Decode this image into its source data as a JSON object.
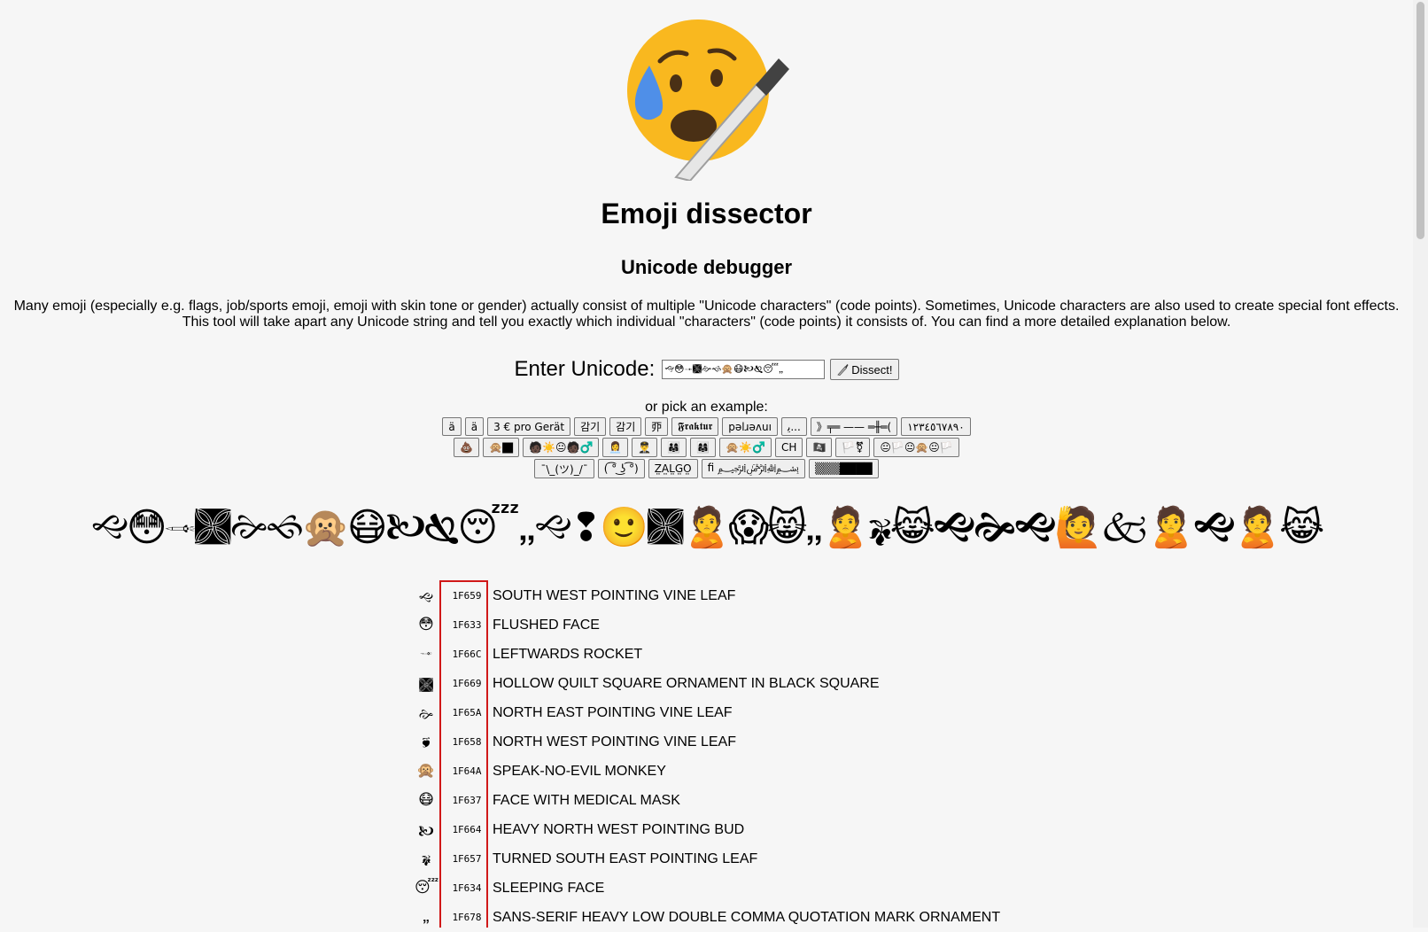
{
  "header": {
    "title": "Emoji dissector",
    "subtitle": "Unicode debugger",
    "intro_line1": "Many emoji (especially e.g. flags, job/sports emoji, emoji with skin tone or gender) actually consist of multiple \"Unicode characters\" (code points). Sometimes, Unicode characters are also used to create special font effects.",
    "intro_line2": "This tool will take apart any Unicode string and tell you exactly which individual \"characters\" (code points) it consists of. You can find a more detailed explanation below."
  },
  "form": {
    "label": "Enter Unicode:",
    "input_value": "🙙😳🙬🙩🙚🙘🙊😷🙤🙗😴🙸",
    "dissect_label": "Dissect!",
    "dissect_icon": "knife-icon"
  },
  "examples": {
    "label": "or pick an example:",
    "row1": [
      "ä",
      "ä",
      "3 € pro Gerät",
      "감기",
      "감기",
      "丣",
      "𝕱𝖗𝖆𝖐𝖙𝖚𝖗",
      "pǝlɹǝʌuı",
      "ﯾ...",
      "》╤═ —— ═╫═(",
      "١٢٣٤٥٦٧٨٩٠"
    ],
    "row2": [
      "💩",
      "🙊🏿",
      "🧑🏿☀️😐🧑🏿♂️",
      "👩‍💼",
      "👨‍✈️",
      "👨‍👩‍👧",
      "👩‍👩‍👧",
      "🙊☀️♂️",
      "CH",
      "🏴‍☠️",
      "🏳️⚧",
      "😐🏳️😐🙊😐🏳️"
    ],
    "row3": [
      "¯\\_(ツ)_/¯",
      "( ͡° ͜ʖ ͡°)",
      "Z̤A̤L̤G̤O̤",
      "ﬁ ﷽",
      "▒▒▒████"
    ]
  },
  "big_string": "🙙😳🙬🙩🙚🙘🙊😷🙤🙗😴🙸🙙❢🙂🙩🙎😱😸🙸🙎🙗😹🙝🙞🙝🙋🙵🙎🙝🙎😹",
  "codepoints": [
    {
      "glyph": "🙙",
      "code": "1F659",
      "name": "SOUTH WEST POINTING VINE LEAF"
    },
    {
      "glyph": "😳",
      "code": "1F633",
      "name": "FLUSHED FACE"
    },
    {
      "glyph": "🙬",
      "code": "1F66C",
      "name": "LEFTWARDS ROCKET"
    },
    {
      "glyph": "🙩",
      "code": "1F669",
      "name": "HOLLOW QUILT SQUARE ORNAMENT IN BLACK SQUARE"
    },
    {
      "glyph": "🙚",
      "code": "1F65A",
      "name": "NORTH EAST POINTING VINE LEAF"
    },
    {
      "glyph": "🙘",
      "code": "1F658",
      "name": "NORTH WEST POINTING VINE LEAF"
    },
    {
      "glyph": "🙊",
      "code": "1F64A",
      "name": "SPEAK-NO-EVIL MONKEY"
    },
    {
      "glyph": "😷",
      "code": "1F637",
      "name": "FACE WITH MEDICAL MASK"
    },
    {
      "glyph": "🙤",
      "code": "1F664",
      "name": "HEAVY NORTH WEST POINTING BUD"
    },
    {
      "glyph": "🙗",
      "code": "1F657",
      "name": "TURNED SOUTH EAST POINTING LEAF"
    },
    {
      "glyph": "😴",
      "code": "1F634",
      "name": "SLEEPING FACE"
    },
    {
      "glyph": "🙸",
      "code": "1F678",
      "name": "SANS-SERIF HEAVY LOW DOUBLE COMMA QUOTATION MARK ORNAMENT"
    }
  ],
  "colors": {
    "highlight": "#d01818",
    "logo_face": "#f9b215",
    "logo_drop": "#4f8fe8"
  }
}
